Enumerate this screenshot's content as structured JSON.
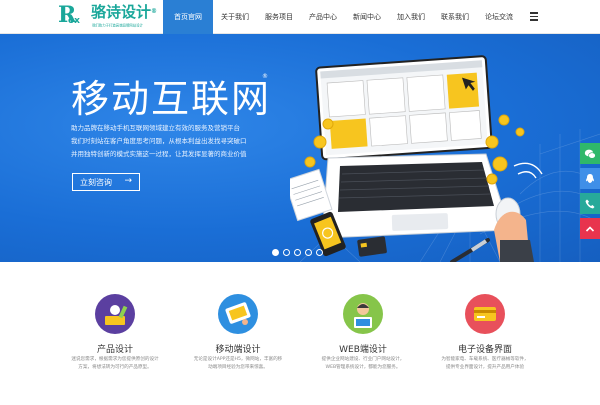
{
  "logo": {
    "r": "R",
    "ox": "ox",
    "name": "骆诗设计",
    "reg": "®",
    "tagline": "我们致力于打造高端品牌网站设计"
  },
  "nav": {
    "items": [
      {
        "label": "首页官网"
      },
      {
        "label": "关于我们"
      },
      {
        "label": "服务项目"
      },
      {
        "label": "产品中心"
      },
      {
        "label": "新闻中心"
      },
      {
        "label": "加入我们"
      },
      {
        "label": "联系我们"
      },
      {
        "label": "论坛交流"
      }
    ],
    "active_index": 0
  },
  "banner": {
    "title": "移动互联网",
    "title_reg": "®",
    "lines": [
      "助力品牌在移动手机互联网领域建立有效的服务及营销平台",
      "我们时刻站在客户角度思考问题，从根本利益出发找寻突破口",
      "并用独特创新的模式实施这一过程，让其发挥显著的商业价值"
    ],
    "button_label": "立刻咨询",
    "button_arrow": "→",
    "slides": 5,
    "active_slide": 0
  },
  "side_buttons": [
    {
      "icon": "wechat-icon",
      "color": "#2fb86a"
    },
    {
      "icon": "qq-icon",
      "color": "#3f8fe8"
    },
    {
      "icon": "phone-icon",
      "color": "#27a99a"
    },
    {
      "icon": "back-to-top-icon",
      "color": "#e8344e"
    }
  ],
  "services": [
    {
      "title": "产品设计",
      "icon": "product-design-icon",
      "color": "#5b3fa0",
      "desc": "迷说您需求，根据需求为您提供原创的设计方案，将想法转为可行的产品原型。"
    },
    {
      "title": "移动端设计",
      "icon": "mobile-design-icon",
      "color": "#2e8fe0",
      "desc": "无论是设计APP还是H5，微网站，丰富的移动端项目经验为您带来惊喜。"
    },
    {
      "title": "WEB端设计",
      "icon": "web-design-icon",
      "color": "#86c54a",
      "desc": "提供企业网站建设、行业门户网站设计，WEB管理系统设计，都能为您服务。"
    },
    {
      "title": "电子设备界面",
      "icon": "device-ui-icon",
      "color": "#e8505b",
      "desc": "为智能家电、车载系统、医疗器械等软件，提供专业界面设计，提升产品用户体验"
    }
  ],
  "colors": {
    "accent": "#2a7fd4",
    "brand": "#1aa79a",
    "banner": "#1a6ed6"
  }
}
